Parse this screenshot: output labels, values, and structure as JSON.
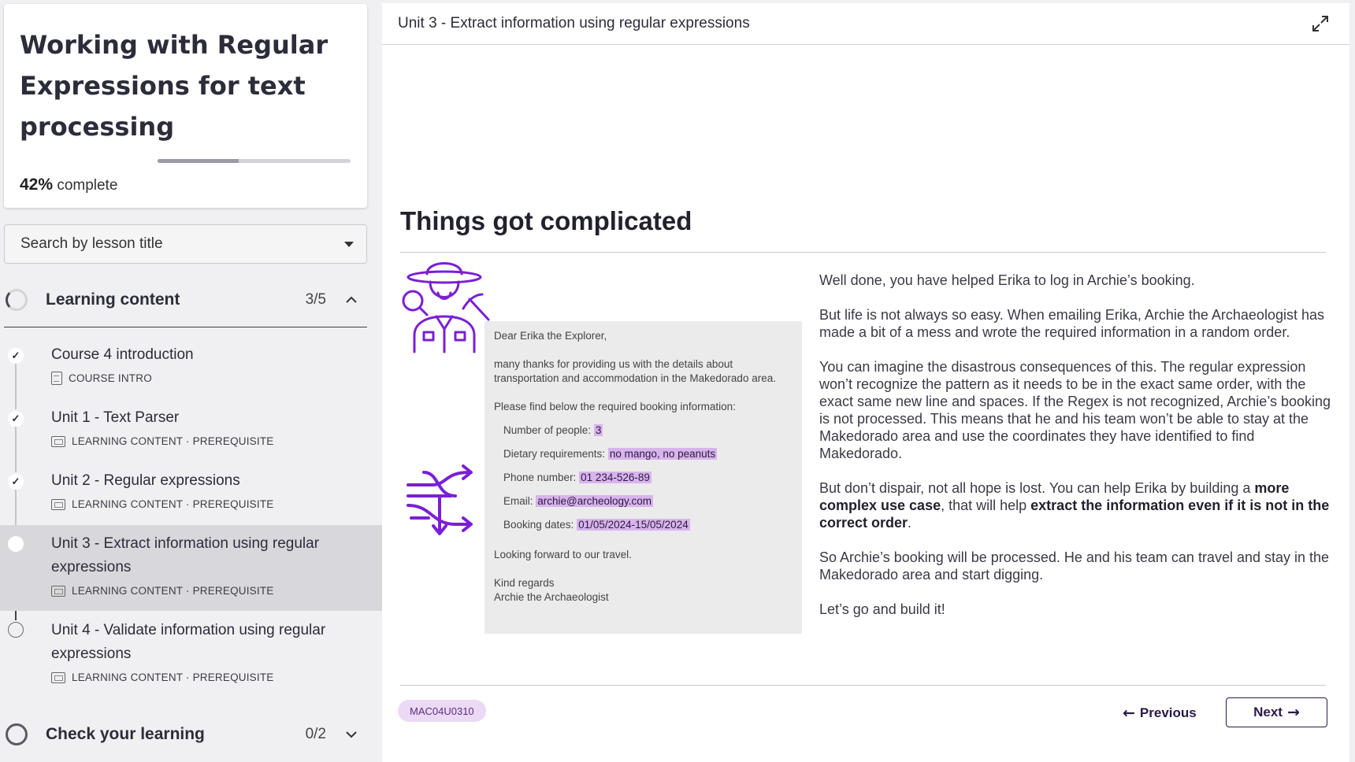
{
  "course": {
    "title": "Working with Regular Expressions for text processing",
    "progress_value": "42%",
    "progress_fraction": 0.42,
    "progress_suffix": "complete"
  },
  "search": {
    "label": "Search by lesson title"
  },
  "sections": [
    {
      "label": "Learning content",
      "count": "3/5"
    },
    {
      "label": "Check your learning",
      "count": "0/2"
    }
  ],
  "lessons": [
    {
      "title": "Course 4 introduction",
      "meta": "COURSE INTRO",
      "status": "✓"
    },
    {
      "title": "Unit 1 - Text Parser",
      "meta": "LEARNING CONTENT · PREREQUISITE",
      "status": "✓"
    },
    {
      "title": "Unit 2 - Regular expressions",
      "meta": "LEARNING CONTENT · PREREQUISITE",
      "status": "✓"
    },
    {
      "title": "Unit 3 - Extract information using regular expressions",
      "meta": "LEARNING CONTENT · PREREQUISITE",
      "status": ""
    },
    {
      "title": "Unit 4 - Validate information using regular expressions",
      "meta": "LEARNING CONTENT · PREREQUISITE",
      "status": ""
    }
  ],
  "main": {
    "unit_title": "Unit 3 - Extract information using regular expressions",
    "heading": "Things got complicated",
    "email": {
      "greeting": "Dear Erika the Explorer,",
      "para1": "many thanks for providing us with the details about transportation and accommodation in the Makedorado area.",
      "para2": "Please find below the required booking information:",
      "rows": [
        {
          "label": "Number of people:",
          "value": "3"
        },
        {
          "label": "Dietary requirements:",
          "value": "no mango, no peanuts"
        },
        {
          "label": "Phone number:",
          "value": "01 234-526-89"
        },
        {
          "label": "Email:",
          "value": "archie@archeology.com"
        },
        {
          "label": "Booking dates:",
          "value": "01/05/2024-15/05/2024"
        }
      ],
      "closing": "Looking forward to our travel.",
      "signoff1": "Kind regards",
      "signoff2": "Archie the Archaeologist"
    },
    "body": {
      "p1": "Well done, you have helped Erika to log in Archie’s booking.",
      "p2": "But life is not always so easy. When emailing Erika, Archie the Archaeologist has made a bit of a mess and wrote the required information in a random order.",
      "p3": "You can imagine the disastrous consequences of this. The regular expression won’t recognize the pattern as it needs to be in the exact same order, with the exact same new line and spaces. If the Regex is not recognized, Archie’s booking is not processed. This means that he and his team won’t be able to stay at the Makedorado area and use the coordinates they have identified to find Makedorado.",
      "p4_a": "But don’t dispair, not all hope is lost. You can help Erika by building a ",
      "p4_b": "more complex use case",
      "p4_c": ", that will help ",
      "p4_d": "extract the information even if it is not in the correct order",
      "p4_e": ".",
      "p5": "So Archie’s booking will be processed. He and his team can travel and stay in the Makedorado area and start digging.",
      "p6": "Let’s go and build it!"
    },
    "code": "MAC04U0310",
    "prev_label": "Previous",
    "next_label": "Next"
  },
  "colors": {
    "accent_purple": "#7a1fd6",
    "highlight": "#d8b4ec",
    "button_text": "#2a1a4a"
  }
}
